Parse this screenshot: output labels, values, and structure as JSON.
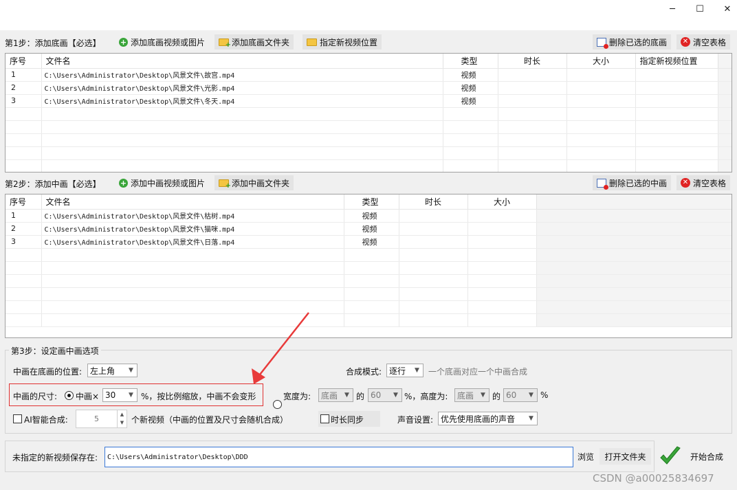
{
  "window": {
    "minimize_label": "─",
    "maximize_label": "☐",
    "close_label": "✕"
  },
  "step1": {
    "label": "第1步：添加底画【必选】",
    "add_video_button": "添加底画视频或图片",
    "add_folder_button": "添加底画文件夹",
    "set_location_button": "指定新视频位置",
    "delete_button": "删除已选的底画",
    "clear_button": "清空表格",
    "columns": [
      "序号",
      "文件名",
      "类型",
      "时长",
      "大小",
      "指定新视频位置"
    ],
    "rows": [
      {
        "no": "1",
        "path": "C:\\Users\\Administrator\\Desktop\\风景文件\\故宫.mp4",
        "type": "视频"
      },
      {
        "no": "2",
        "path": "C:\\Users\\Administrator\\Desktop\\风景文件\\光影.mp4",
        "type": "视频"
      },
      {
        "no": "3",
        "path": "C:\\Users\\Administrator\\Desktop\\风景文件\\冬天.mp4",
        "type": "视频"
      }
    ]
  },
  "step2": {
    "label": "第2步：添加中画【必选】",
    "add_video_button": "添加中画视频或图片",
    "add_folder_button": "添加中画文件夹",
    "delete_button": "删除已选的中画",
    "clear_button": "清空表格",
    "columns": [
      "序号",
      "文件名",
      "类型",
      "时长",
      "大小"
    ],
    "rows": [
      {
        "no": "1",
        "path": "C:\\Users\\Administrator\\Desktop\\风景文件\\枯树.mp4",
        "type": "视频"
      },
      {
        "no": "2",
        "path": "C:\\Users\\Administrator\\Desktop\\风景文件\\猫咪.mp4",
        "type": "视频"
      },
      {
        "no": "3",
        "path": "C:\\Users\\Administrator\\Desktop\\风景文件\\日落.mp4",
        "type": "视频"
      }
    ]
  },
  "step3": {
    "title": "第3步：设定画中画选项",
    "position_label": "中画在底画的位置:",
    "position_value": "左上角",
    "mode_label": "合成模式:",
    "mode_value": "逐行",
    "mode_hint": "一个底画对应一个中画合成",
    "size_label": "中画的尺寸:",
    "scale_radio_label": "中画×",
    "scale_value": "30",
    "scale_suffix": "%，按比例缩放，中画不会变形",
    "width_radio_label": "宽度为:",
    "width_ref": "底画",
    "width_of": "的",
    "width_value": "60",
    "width_suffix": "%，高度为:",
    "height_ref": "底画",
    "height_of": "的",
    "height_value": "60",
    "height_suffix": "%",
    "ai_label": "AI智能合成:",
    "ai_count": "5",
    "ai_suffix": "个新视频（中画的位置及尺寸会随机合成）",
    "duration_sync_label": "时长同步",
    "sound_label": "声音设置:",
    "sound_value": "优先使用底画的声音"
  },
  "output": {
    "label": "未指定的新视频保存在:",
    "path": "C:\\Users\\Administrator\\Desktop\\DDD",
    "browse_button": "浏览",
    "open_folder_button": "打开文件夹",
    "start_button": "开始合成"
  },
  "watermark": "CSDN @a00025834697",
  "colors": {
    "highlight_border": "#e03030",
    "annotation_arrow": "#e83a3a",
    "start_check": "#3aa53a",
    "input_focus": "#3a78d6"
  }
}
